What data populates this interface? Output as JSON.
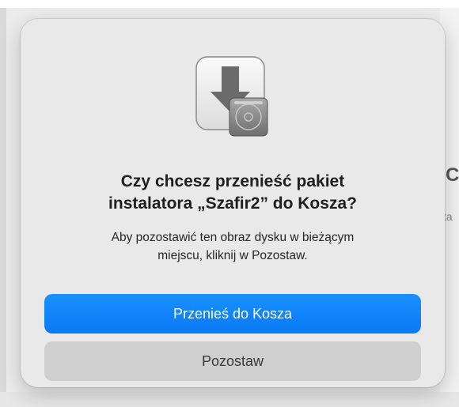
{
  "dialog": {
    "icon": "disk-image-installer-icon",
    "title_line1": "Czy chcesz przenieść pakiet",
    "title_line2": "instalatora „Szafir2” do Kosza?",
    "message_line1": "Aby pozostawić ten obraz dysku w bieżącym",
    "message_line2": "miejscu, kliknij w Pozostaw.",
    "primary_button": "Przenieś do Kosza",
    "secondary_button": "Pozostaw"
  },
  "background": {
    "partial_text_1": "C",
    "partial_text_2": "ta"
  },
  "colors": {
    "accent": "#0a7af5",
    "dialog_bg": "#e9e9e9",
    "secondary_button_bg": "#cfcfcf"
  }
}
